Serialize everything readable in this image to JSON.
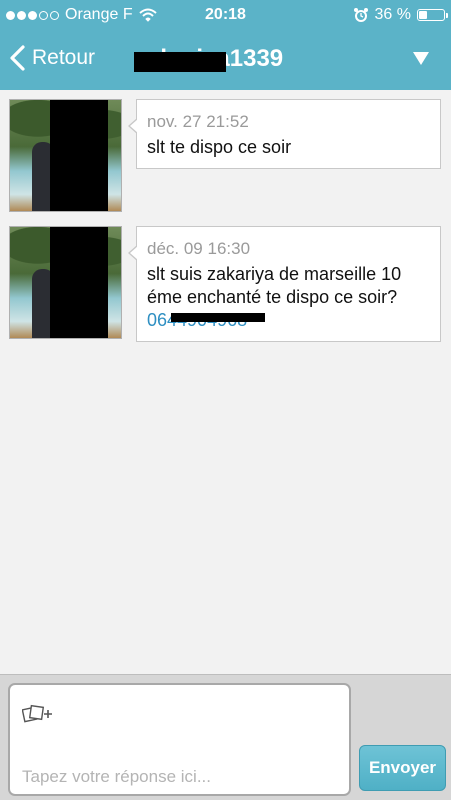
{
  "status_bar": {
    "carrier": "Orange F",
    "time": "20:18",
    "battery_percent": "36 %",
    "battery_level": 0.36,
    "signal_bars_filled": 3,
    "signal_bars_total": 5
  },
  "nav": {
    "back_label": "Retour",
    "title": "zakariya1339"
  },
  "messages": [
    {
      "time": "nov. 27 21:52",
      "text": "slt te dispo ce soir"
    },
    {
      "time": "déc. 09 16:30",
      "text": "slt suis zakariya de marseille 10 éme enchanté te dispo ce soir?",
      "link": "0644904968"
    }
  ],
  "composer": {
    "placeholder": "Tapez votre réponse ici...",
    "send_label": "Envoyer"
  },
  "colors": {
    "accent": "#5bb3c8",
    "link": "#2e8fc2"
  }
}
